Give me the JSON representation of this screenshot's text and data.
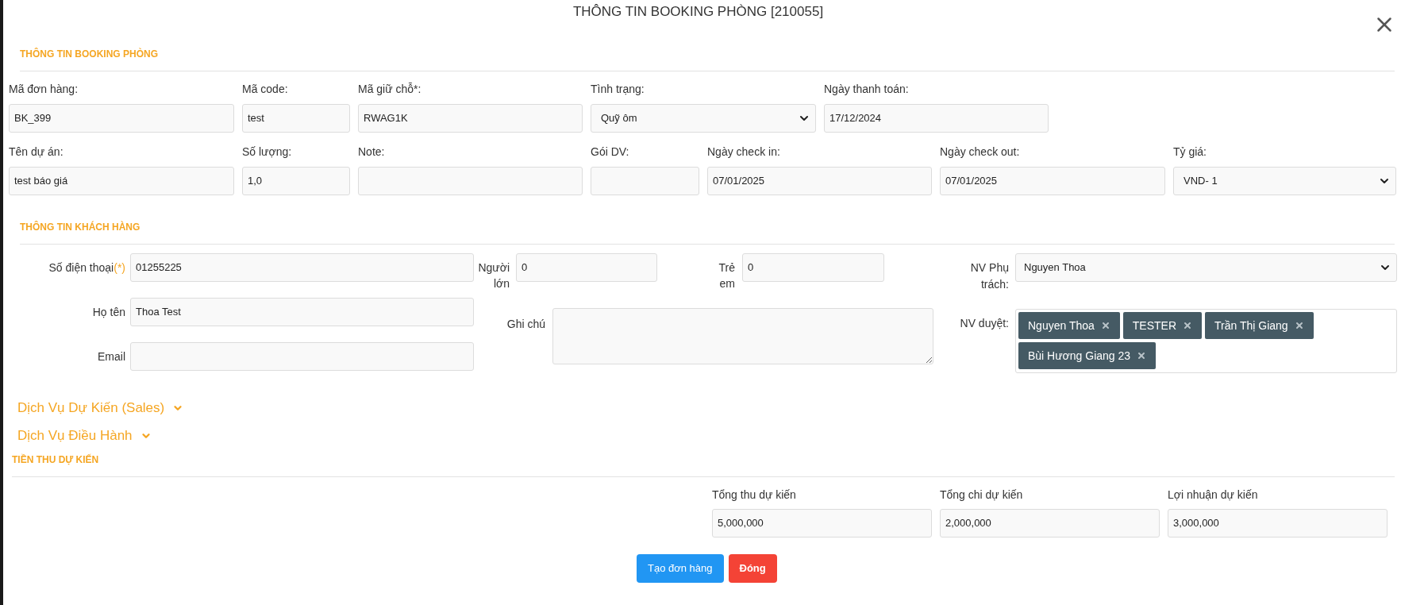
{
  "modal": {
    "title": "THÔNG TIN BOOKING PHÒNG [210055]"
  },
  "booking": {
    "heading": "THÔNG TIN BOOKING PHÒNG",
    "rows": [
      [
        {
          "label": "Mã đơn hàng:",
          "value": "BK_399",
          "kind": "input"
        },
        {
          "label": "Mã code:",
          "value": "test",
          "kind": "input"
        },
        {
          "label": "Mã giữ chỗ*:",
          "value": "RWAG1K",
          "kind": "input"
        },
        {
          "label": "Tình trạng:",
          "value": "Quỹ ôm",
          "kind": "select"
        },
        {
          "label": "Ngày thanh toán:",
          "value": "17/12/2024",
          "kind": "input"
        }
      ],
      [
        {
          "label": "Tên dự án:",
          "value": "test báo giá",
          "kind": "input"
        },
        {
          "label": "Số lượng:",
          "value": "1,0",
          "kind": "input"
        },
        {
          "label": "Note:",
          "kind": "input"
        },
        {
          "label": "Gói DV:",
          "kind": "input"
        },
        {
          "label": "Ngày check in:",
          "value": "07/01/2025",
          "kind": "input"
        },
        {
          "label": "Ngày check out:",
          "value": "07/01/2025",
          "kind": "input"
        },
        {
          "label": "Tỷ giá:",
          "value": "VND- 1",
          "kind": "select"
        }
      ]
    ]
  },
  "customer": {
    "heading": "THÔNG TIN KHÁCH HÀNG",
    "phone": {
      "label": "Số điện thoại",
      "required_mark": "(*)",
      "value": "01255225"
    },
    "name": {
      "label": "Họ tên",
      "value": "Thoa Test"
    },
    "email": {
      "label": "Email"
    },
    "adults": {
      "label": "Người lớn",
      "value": "0"
    },
    "children": {
      "label": "Trẻ em",
      "value": "0"
    },
    "note": {
      "label": "Ghi chú"
    },
    "staff": {
      "label": "NV Phụ trách:",
      "value": "Nguyen Thoa"
    },
    "approvers": {
      "label": "NV duyệt:",
      "tags": [
        "Nguyen Thoa",
        "TESTER",
        "Trần Thị Giang",
        "Bùi Hương Giang 23"
      ]
    }
  },
  "collapsibles": [
    {
      "label": "Dịch Vụ Dự Kiến (Sales)",
      "expanded": false
    },
    {
      "label": "Dịch Vụ Điều Hành",
      "expanded": false
    }
  ],
  "totals": {
    "heading": "TIỀN THU DỰ KIẾN",
    "fields": [
      {
        "label": "Tổng thu dự kiến",
        "value": "5,000,000"
      },
      {
        "label": "Tổng chi dự kiến",
        "value": "2,000,000"
      },
      {
        "label": "Lợi nhuận dự kiến",
        "value": "3,000,000"
      }
    ]
  },
  "buttons": [
    {
      "label": "Tạo đơn hàng",
      "kind": "primary"
    },
    {
      "label": "Đóng",
      "kind": "danger"
    }
  ]
}
